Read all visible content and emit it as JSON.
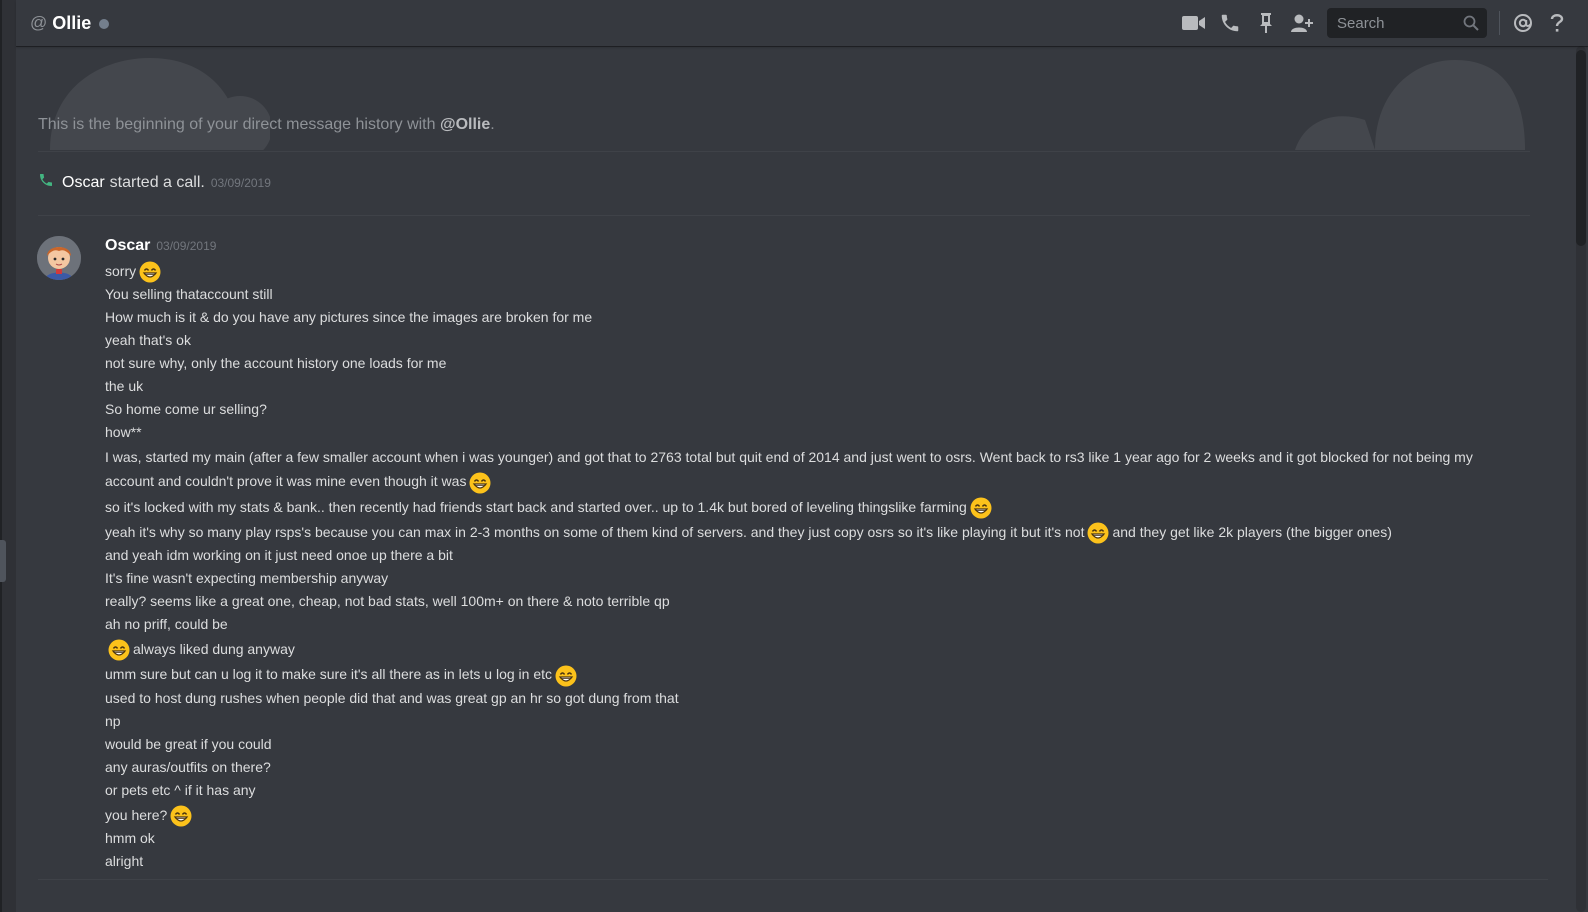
{
  "header": {
    "at_symbol": "@",
    "title": "Ollie",
    "search_placeholder": "Search",
    "icons": [
      "video-call-icon",
      "voice-call-icon",
      "pin-icon",
      "add-friend-icon",
      "search-icon",
      "mention-icon",
      "help-icon"
    ]
  },
  "intro": {
    "text": "This is the beginning of your direct message history with ",
    "mention": "@Ollie",
    "period": "."
  },
  "call_event": {
    "name": "Oscar",
    "text": "started a call.",
    "timestamp": "03/09/2019"
  },
  "message_group": {
    "author": "Oscar",
    "timestamp": "03/09/2019",
    "lines": [
      {
        "pre": "sorry",
        "post": "",
        "emoji": true
      },
      {
        "pre": "You selling thataccount still",
        "post": "",
        "emoji": false
      },
      {
        "pre": "How much is it & do you have any pictures since the images are broken for me",
        "post": "",
        "emoji": false
      },
      {
        "pre": "yeah that's ok",
        "post": "",
        "emoji": false
      },
      {
        "pre": "not sure why, only the account history one loads for me",
        "post": "",
        "emoji": false
      },
      {
        "pre": "the uk",
        "post": "",
        "emoji": false
      },
      {
        "pre": "So home come ur selling?",
        "post": "",
        "emoji": false
      },
      {
        "pre": "how**",
        "post": "",
        "emoji": false
      },
      {
        "pre": "I was, started my main (after a few smaller account when i was younger) and got that to 2763 total but quit end of 2014 and just went to osrs. Went back to rs3 like 1 year ago for 2 weeks and it got blocked for not being my account and couldn't prove it was mine even though it was",
        "post": "",
        "emoji": true
      },
      {
        "pre": "so it's locked with my stats & bank.. then recently had friends start back and started over.. up to 1.4k but bored of leveling thingslike farming",
        "post": "",
        "emoji": true
      },
      {
        "pre": "yeah it's why so many play rsps's because you can max in 2-3 months on some of them kind of servers. and they just copy osrs so it's like playing it but it's not",
        "post": "and they get like 2k players (the bigger ones)",
        "emoji": true
      },
      {
        "pre": "and yeah idm working on it just need onoe up there a bit",
        "post": "",
        "emoji": false
      },
      {
        "pre": "It's fine wasn't expecting membership anyway",
        "post": "",
        "emoji": false
      },
      {
        "pre": "really? seems like a great one, cheap, not bad stats, well 100m+ on there & noto terrible qp",
        "post": "",
        "emoji": false
      },
      {
        "pre": "ah no priff, could be",
        "post": "",
        "emoji": false
      },
      {
        "pre": "",
        "post": "always liked dung anyway",
        "emoji": true
      },
      {
        "pre": "umm sure but can u log it to make sure it's all there as in lets u log in etc",
        "post": "",
        "emoji": true
      },
      {
        "pre": "used to host dung rushes when people did that and was great gp an hr so got dung from that",
        "post": "",
        "emoji": false
      },
      {
        "pre": "np",
        "post": "",
        "emoji": false
      },
      {
        "pre": "would be great if you could",
        "post": "",
        "emoji": false
      },
      {
        "pre": "any auras/outfits on there?",
        "post": "",
        "emoji": false
      },
      {
        "pre": "or pets etc ^ if it has any",
        "post": "",
        "emoji": false
      },
      {
        "pre": "you here?",
        "post": "",
        "emoji": true
      },
      {
        "pre": "hmm ok",
        "post": "",
        "emoji": false
      },
      {
        "pre": "alright",
        "post": "",
        "emoji": false
      }
    ]
  },
  "colors": {
    "background": "#36393f",
    "header_text": "#ffffff",
    "muted": "#8e9297",
    "message_text": "#dcddde",
    "call_green": "#43b581",
    "emoji_yellow": "#fcc21b"
  }
}
